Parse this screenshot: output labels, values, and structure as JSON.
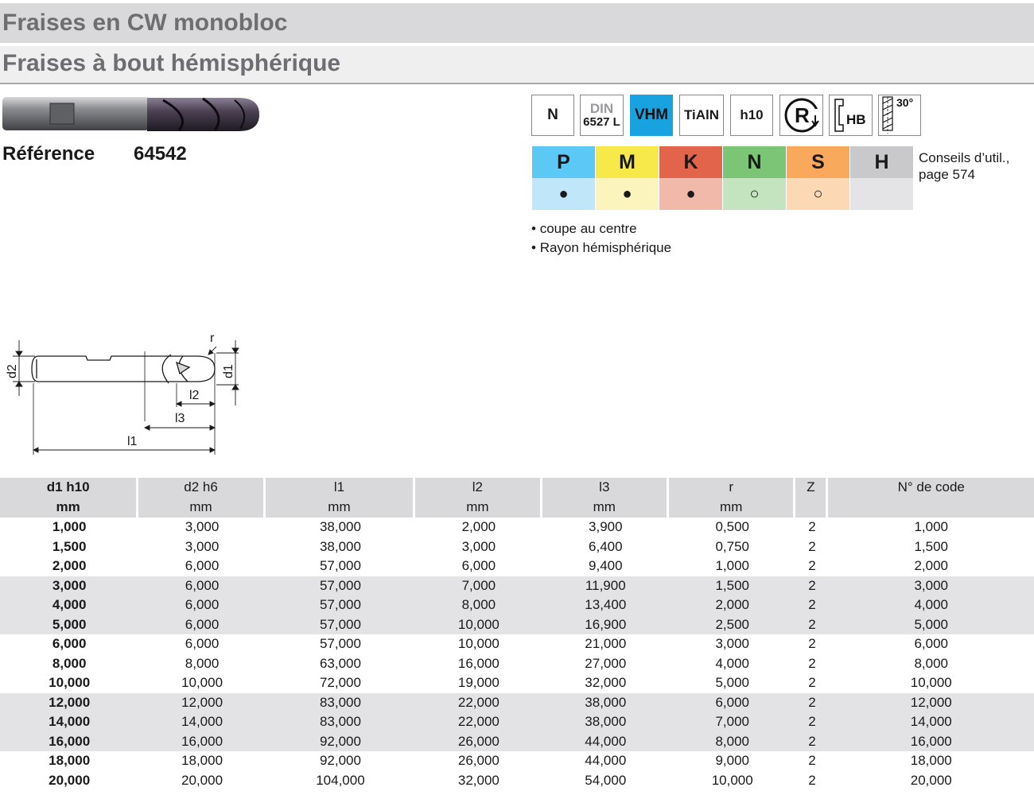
{
  "header": {
    "title": "Fraises en CW monobloc",
    "subtitle": "Fraises à bout hémisphérique"
  },
  "reference": {
    "label": "Référence",
    "number": "64542"
  },
  "icons": [
    {
      "name": "n-icon",
      "label": "N"
    },
    {
      "name": "din-icon",
      "label_top": "DIN",
      "label_bottom": "6527 L"
    },
    {
      "name": "vhm-icon",
      "label": "VHM"
    },
    {
      "name": "tialn-icon",
      "label": "TiAlN"
    },
    {
      "name": "h10-icon",
      "label": "h10"
    },
    {
      "name": "right-hand-rotation-icon",
      "label": "R"
    },
    {
      "name": "hb-shank-icon",
      "label": "HB"
    },
    {
      "name": "helix-30-icon",
      "label": "30°"
    }
  ],
  "materials": [
    {
      "code": "P",
      "color": "#5bc8f5",
      "light": "#bfe6f9",
      "mark": "●"
    },
    {
      "code": "M",
      "color": "#f8e94a",
      "light": "#fbf4bd",
      "mark": "●"
    },
    {
      "code": "K",
      "color": "#e2644a",
      "light": "#f0b9aa",
      "mark": "●"
    },
    {
      "code": "N",
      "color": "#7cc576",
      "light": "#c3e4bf",
      "mark": "○"
    },
    {
      "code": "S",
      "color": "#f9a85c",
      "light": "#fcd8b4",
      "mark": "○"
    },
    {
      "code": "H",
      "color": "#c9c9cb",
      "light": "#e4e4e6",
      "mark": ""
    }
  ],
  "conseils": {
    "line1": "Conseils d’util.,",
    "line2": "page 574"
  },
  "features": [
    "coupe au centre",
    "Rayon hémisphérique"
  ],
  "drawing_labels": {
    "d2": "d2",
    "d1": "d1",
    "r": "r",
    "l1": "l1",
    "l2": "l2",
    "l3": "l3"
  },
  "table": {
    "headers": [
      {
        "top": "d1 h10",
        "unit": "mm"
      },
      {
        "top": "d2 h6",
        "unit": "mm"
      },
      {
        "top": "l1",
        "unit": "mm"
      },
      {
        "top": "l2",
        "unit": "mm"
      },
      {
        "top": "l3",
        "unit": "mm"
      },
      {
        "top": "r",
        "unit": "mm"
      },
      {
        "top": "Z",
        "unit": ""
      },
      {
        "top": "N° de code",
        "unit": ""
      }
    ],
    "rows": [
      [
        "1,000",
        "3,000",
        "38,000",
        "2,000",
        "3,900",
        "0,500",
        "2",
        "1,000"
      ],
      [
        "1,500",
        "3,000",
        "38,000",
        "3,000",
        "6,400",
        "0,750",
        "2",
        "1,500"
      ],
      [
        "2,000",
        "6,000",
        "57,000",
        "6,000",
        "9,400",
        "1,000",
        "2",
        "2,000"
      ],
      [
        "3,000",
        "6,000",
        "57,000",
        "7,000",
        "11,900",
        "1,500",
        "2",
        "3,000"
      ],
      [
        "4,000",
        "6,000",
        "57,000",
        "8,000",
        "13,400",
        "2,000",
        "2",
        "4,000"
      ],
      [
        "5,000",
        "6,000",
        "57,000",
        "10,000",
        "16,900",
        "2,500",
        "2",
        "5,000"
      ],
      [
        "6,000",
        "6,000",
        "57,000",
        "10,000",
        "21,000",
        "3,000",
        "2",
        "6,000"
      ],
      [
        "8,000",
        "8,000",
        "63,000",
        "16,000",
        "27,000",
        "4,000",
        "2",
        "8,000"
      ],
      [
        "10,000",
        "10,000",
        "72,000",
        "19,000",
        "32,000",
        "5,000",
        "2",
        "10,000"
      ],
      [
        "12,000",
        "12,000",
        "83,000",
        "22,000",
        "38,000",
        "6,000",
        "2",
        "12,000"
      ],
      [
        "14,000",
        "14,000",
        "83,000",
        "22,000",
        "38,000",
        "7,000",
        "2",
        "14,000"
      ],
      [
        "16,000",
        "16,000",
        "92,000",
        "26,000",
        "44,000",
        "8,000",
        "2",
        "16,000"
      ],
      [
        "18,000",
        "18,000",
        "92,000",
        "26,000",
        "44,000",
        "9,000",
        "2",
        "18,000"
      ],
      [
        "20,000",
        "20,000",
        "104,000",
        "32,000",
        "54,000",
        "10,000",
        "2",
        "20,000"
      ]
    ]
  }
}
